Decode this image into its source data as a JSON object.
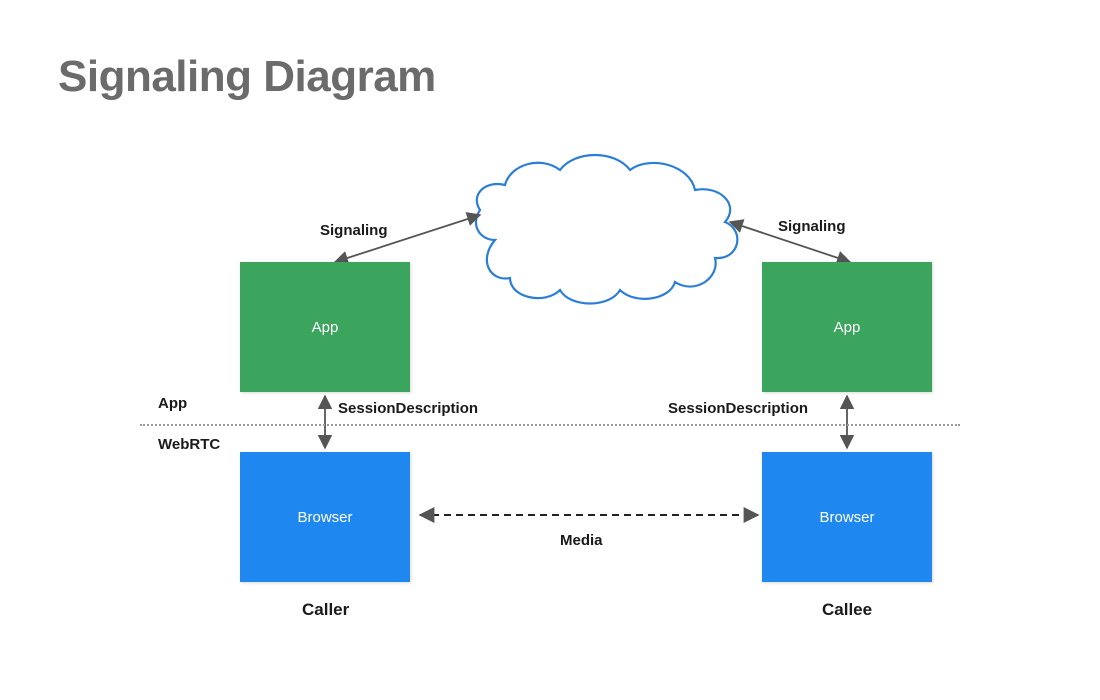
{
  "title": "Signaling Diagram",
  "sections": {
    "upper": "App",
    "lower": "WebRTC"
  },
  "boxes": {
    "caller_app": "App",
    "callee_app": "App",
    "caller_browser": "Browser",
    "callee_browser": "Browser"
  },
  "labels": {
    "signaling_left": "Signaling",
    "signaling_right": "Signaling",
    "session_desc_left": "SessionDescription",
    "session_desc_right": "SessionDescription",
    "media": "Media",
    "caller": "Caller",
    "callee": "Callee"
  }
}
